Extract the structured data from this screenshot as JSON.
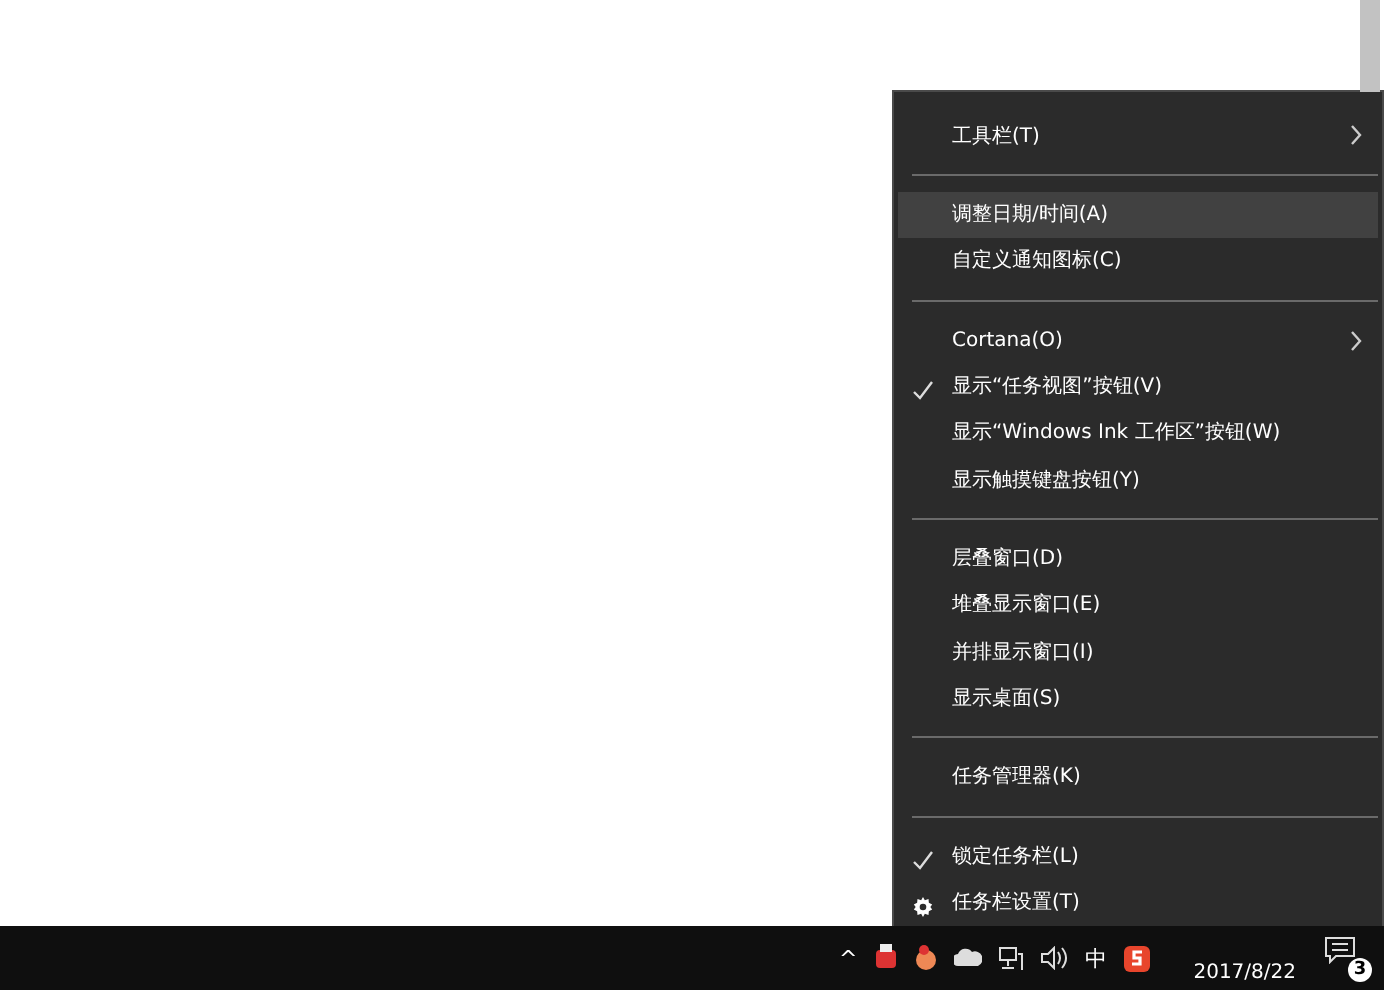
{
  "context_menu": {
    "groups": [
      {
        "items": [
          {
            "kind": "submenu",
            "label": "工具栏(T)",
            "checked": false,
            "selected": false
          }
        ]
      },
      {
        "items": [
          {
            "kind": "command",
            "label": "调整日期/时间(A)",
            "checked": false,
            "selected": true
          },
          {
            "kind": "command",
            "label": "自定义通知图标(C)",
            "checked": false,
            "selected": false
          }
        ]
      },
      {
        "items": [
          {
            "kind": "submenu",
            "label": "Cortana(O)",
            "checked": false,
            "selected": false
          },
          {
            "kind": "command",
            "label": "显示“任务视图”按钮(V)",
            "checked": true,
            "selected": false
          },
          {
            "kind": "command",
            "label": "显示“Windows Ink 工作区”按钮(W)",
            "checked": false,
            "selected": false
          },
          {
            "kind": "command",
            "label": "显示触摸键盘按钮(Y)",
            "checked": false,
            "selected": false
          }
        ]
      },
      {
        "items": [
          {
            "kind": "command",
            "label": "层叠窗口(D)",
            "checked": false,
            "selected": false
          },
          {
            "kind": "command",
            "label": "堆叠显示窗口(E)",
            "checked": false,
            "selected": false
          },
          {
            "kind": "command",
            "label": "并排显示窗口(I)",
            "checked": false,
            "selected": false
          },
          {
            "kind": "command",
            "label": "显示桌面(S)",
            "checked": false,
            "selected": false
          }
        ]
      },
      {
        "items": [
          {
            "kind": "command",
            "label": "任务管理器(K)",
            "checked": false,
            "selected": false
          }
        ]
      },
      {
        "items": [
          {
            "kind": "command",
            "label": "锁定任务栏(L)",
            "checked": true,
            "selected": false
          },
          {
            "kind": "settings",
            "label": "任务栏设置(T)",
            "checked": false,
            "selected": false
          }
        ]
      }
    ]
  },
  "taskbar": {
    "tray_overflow": "^",
    "input_method": "中",
    "date": "2017/8/22",
    "notification_count": "3"
  }
}
